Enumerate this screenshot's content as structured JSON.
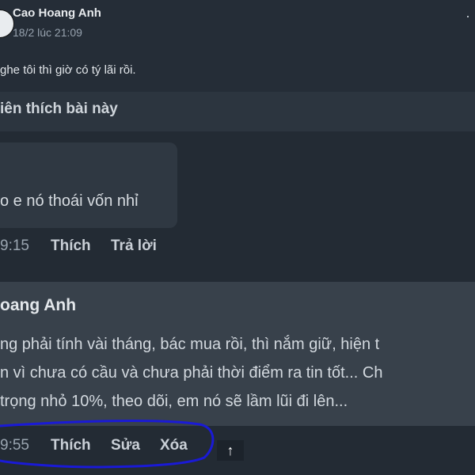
{
  "post": {
    "author": "Cao Hoang Anh",
    "time": "18/2 lúc 21:09",
    "more_icon": "more-dots-icon",
    "text": "ghe tôi thì giờ có tý lãi rồi."
  },
  "likes": {
    "text": "iên thích bài này"
  },
  "comments": [
    {
      "text": "o e nó thoái vốn nhỉ",
      "time": "9:15",
      "like_label": "Thích",
      "reply_label": "Trả lời"
    },
    {
      "author": "oang Anh",
      "lines": [
        "ng phải tính vài tháng, bác mua rồi, thì nắm giữ, hiện t",
        "n vì chưa có cầu và chưa phải thời điểm ra tin tốt... Ch",
        " trọng nhỏ 10%, theo dõi, em nó sẽ lầm lũi đi lên..."
      ],
      "time": "9:55",
      "like_label": "Thích",
      "edit_label": "Sửa",
      "delete_label": "Xóa"
    }
  ],
  "scroll_top": {
    "icon": "arrow-up-icon",
    "glyph": "↑"
  },
  "annotation": {
    "color": "#1a1ad6"
  }
}
